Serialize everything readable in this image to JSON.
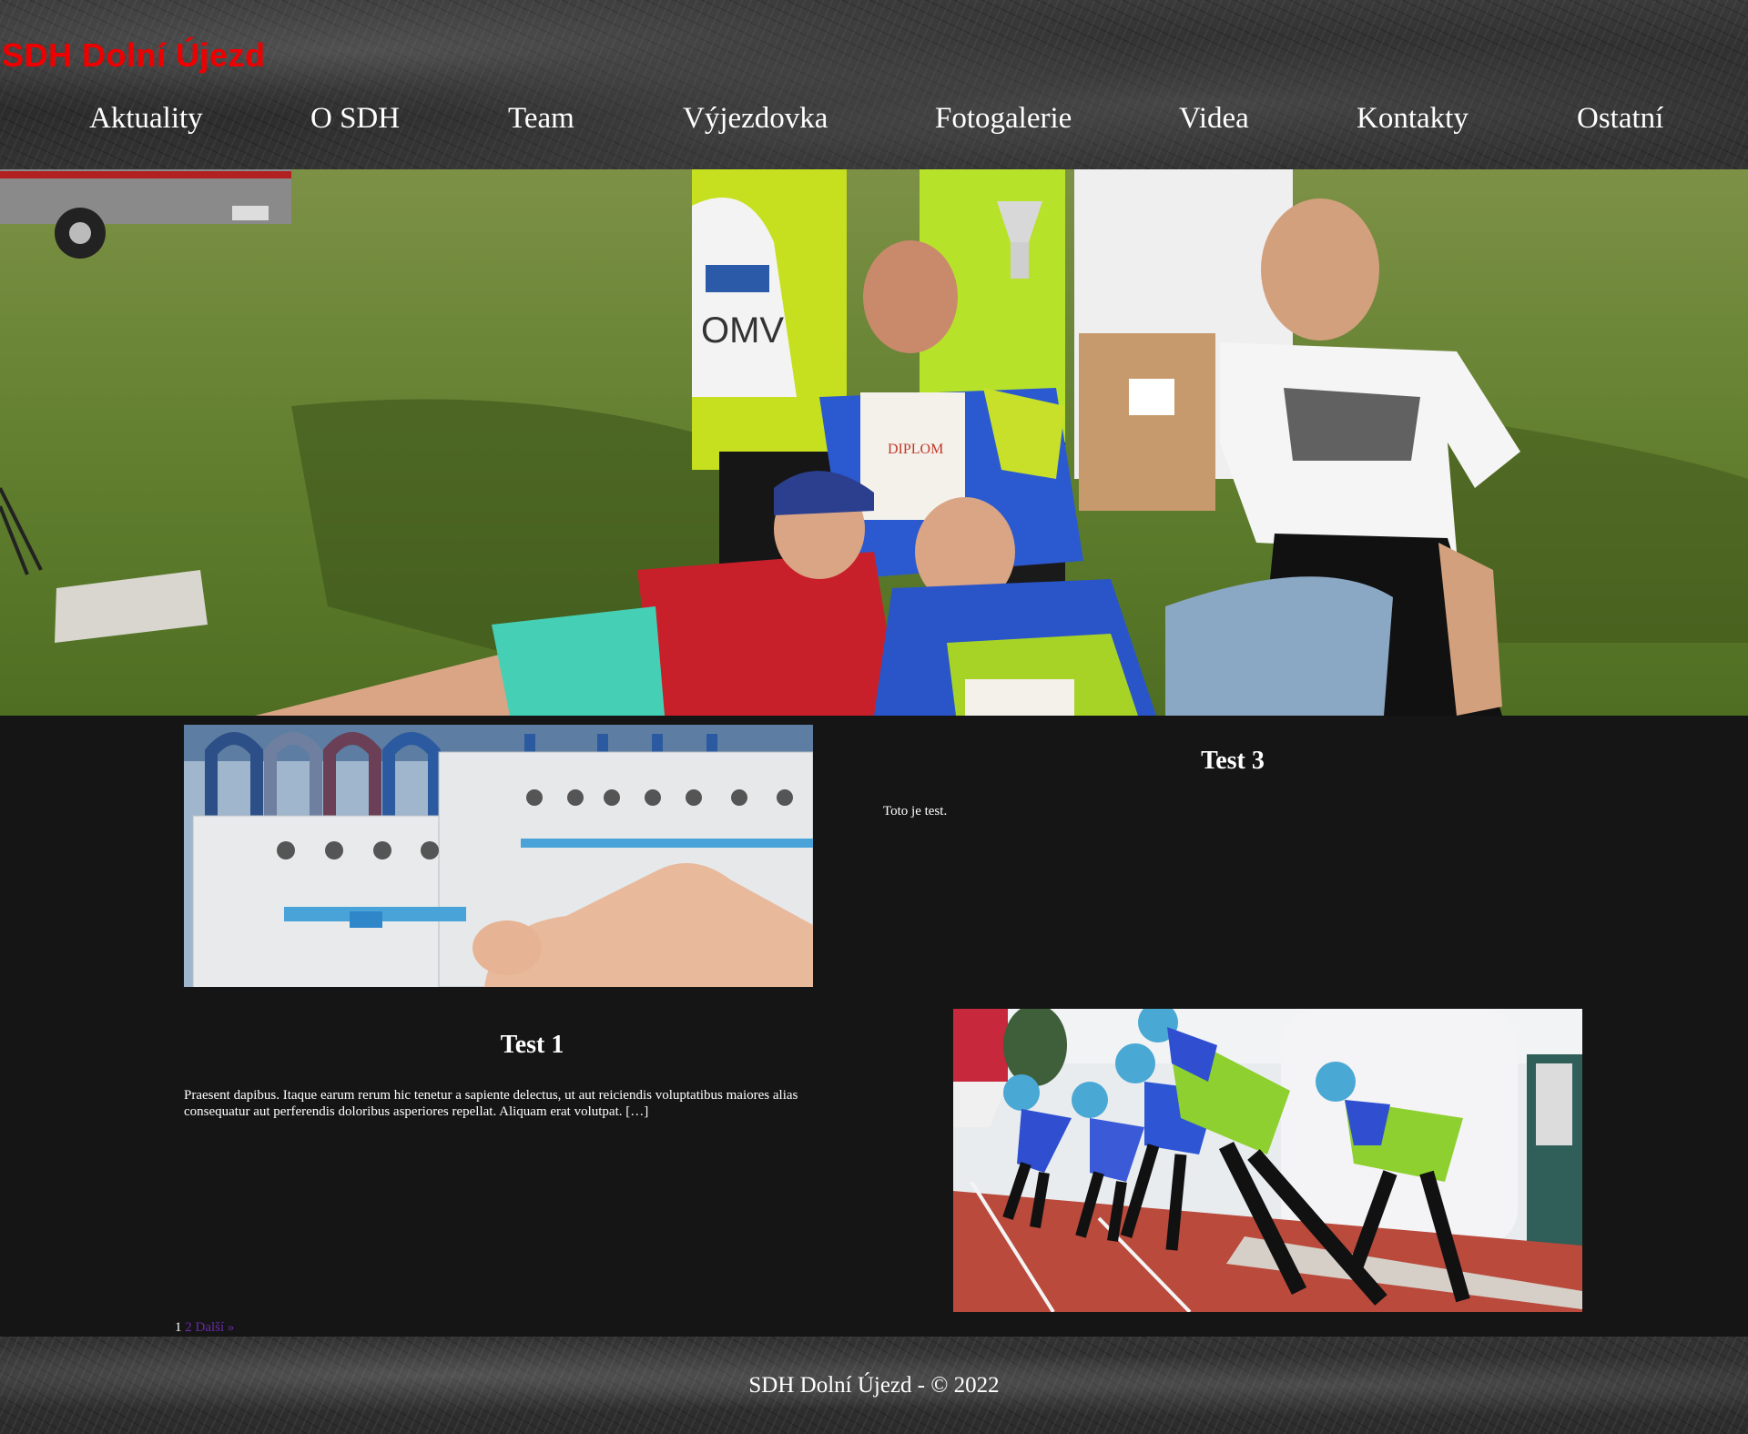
{
  "site": {
    "title": "SDH Dolní Újezd"
  },
  "nav": {
    "items": [
      "Aktuality",
      "O SDH",
      "Team",
      "Výjezdovka",
      "Fotogalerie",
      "Videa",
      "Kontakty",
      "Ostatní"
    ]
  },
  "hero": {
    "image_icon": "team-photo-image",
    "bag_text": "OMV",
    "diploma_text": "DIPLOM"
  },
  "posts": [
    {
      "title": "Test 3",
      "excerpt": "Toto je test.",
      "image_icon": "circuit-breaker-image"
    },
    {
      "title": "Test 1",
      "excerpt": "Praesent dapibus. Itaque earum rerum hic tenetur a sapiente delectus, ut aut reiciendis voluptatibus maiores alias consequatur aut perferendis doloribus asperiores repellat. Aliquam erat volutpat. […]",
      "image_icon": "firefighter-sprint-image"
    }
  ],
  "pagination": {
    "current": "1",
    "next": "2 Další »"
  },
  "footer": {
    "text": "SDH Dolní Újezd - © 2022"
  },
  "colors": {
    "title_red": "#ee0000",
    "page_bg": "#151515",
    "link_purple": "#6a2aa8"
  }
}
